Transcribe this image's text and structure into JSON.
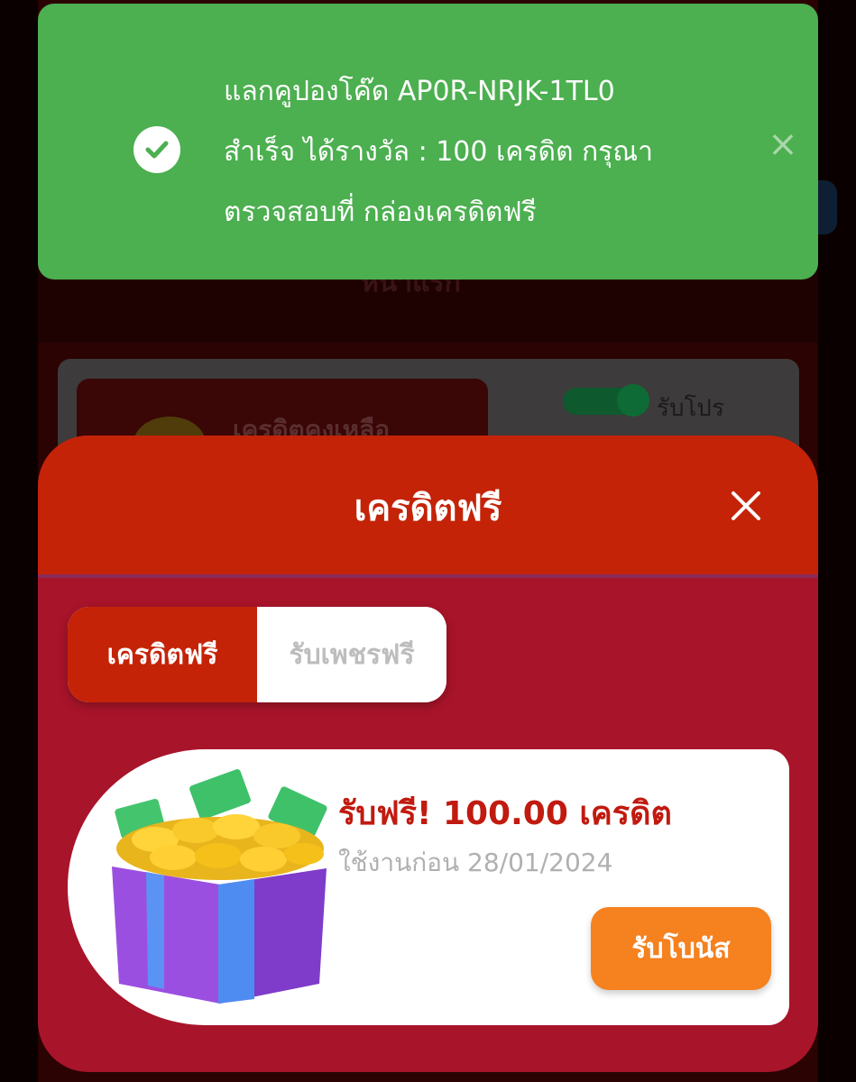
{
  "background": {
    "header_text": "หน้าแรก",
    "credit_label": "เครดิตคงเหลือ",
    "promo_toggle_label": "รับโปร"
  },
  "toast": {
    "line1": "แลกคูปองโค๊ด AP0R-NRJK-1TL0",
    "line2": "สำเร็จ ได้รางวัล : 100 เครดิต กรุณา",
    "line3": "ตรวจสอบที่ กล่องเครดิตฟรี",
    "close_icon": "×",
    "status_icon": "check-circle-icon",
    "color": "#4caf50"
  },
  "modal": {
    "title": "เครดิตฟรี",
    "close_icon": "close-icon",
    "header_color": "#c42308",
    "body_color": "#a8142a",
    "tabs": [
      {
        "label": "เครดิตฟรี",
        "active": true
      },
      {
        "label": "รับเพชรฟรี",
        "active": false
      }
    ],
    "reward": {
      "title": "รับฟรี! 100.00 เครดิต",
      "expiry": "ใช้งานก่อน 28/01/2024",
      "button_label": "รับโบนัส",
      "image_icon": "gift-box-icon"
    }
  }
}
